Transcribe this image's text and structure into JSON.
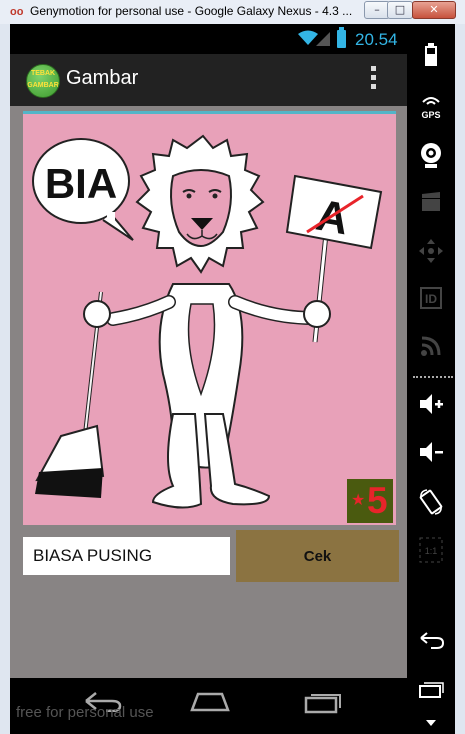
{
  "window": {
    "title": "Genymotion for personal use - Google Galaxy Nexus - 4.3 ...",
    "logo_text": "oo",
    "minimize_glyph": "–",
    "maximize_glyph": "□",
    "close_glyph": "✕"
  },
  "statusbar": {
    "time": "20.54",
    "wifi_icon": "wifi-icon",
    "signal_icon": "signal-icon",
    "battery_icon": "battery-icon",
    "accent_color": "#33b5e5"
  },
  "actionbar": {
    "app_icon_text_top": "TEBAK",
    "app_icon_text_bottom": "GAMBAR",
    "title": "Gambar",
    "overflow_icon": "overflow-menu-icon"
  },
  "puzzle": {
    "speech_text": "BIA",
    "sign_text": "A",
    "level": "5",
    "star_glyph": "★",
    "background_color": "#e8a1b9"
  },
  "answer": {
    "value": "BIASA PUSING"
  },
  "check_button": {
    "label": "Cek"
  },
  "navbar": {
    "watermark": "free for personal use"
  },
  "sidebar_icons": [
    "battery-icon",
    "gps-icon",
    "camera-icon",
    "clapperboard-icon",
    "dpad-icon",
    "id-icon",
    "rss-icon",
    "volume-up-icon",
    "volume-down-icon",
    "rotate-icon",
    "pixel-ratio-icon",
    "back-icon",
    "recent-apps-icon",
    "menu-icon"
  ],
  "sidebar_labels": {
    "gps": "GPS",
    "id": "ID",
    "ratio": "1:1"
  }
}
